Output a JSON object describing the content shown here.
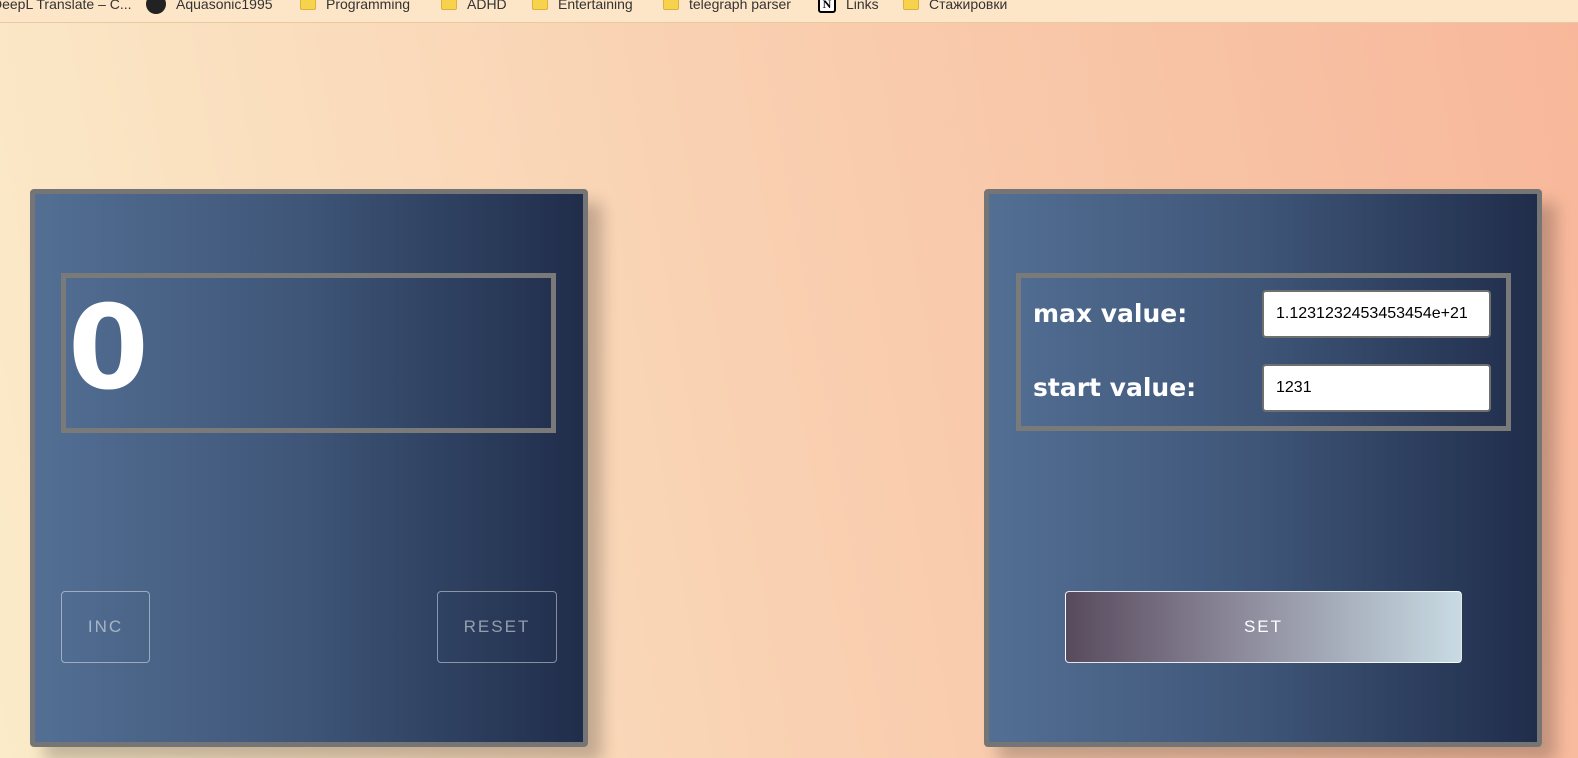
{
  "bookmarks": [
    {
      "label": "DeepL Translate – C...",
      "icon": "translate-icon"
    },
    {
      "label": "Aquasonic1995",
      "icon": "github-icon"
    },
    {
      "label": "Programming",
      "icon": "folder-icon"
    },
    {
      "label": "ADHD",
      "icon": "folder-icon"
    },
    {
      "label": "Entertaining",
      "icon": "folder-icon"
    },
    {
      "label": "telegraph parser",
      "icon": "folder-icon"
    },
    {
      "label": "Links",
      "icon": "notion-icon"
    },
    {
      "label": "Стажировки",
      "icon": "folder-icon"
    }
  ],
  "counter": {
    "value": "0",
    "inc_label": "INC",
    "reset_label": "RESET"
  },
  "settings": {
    "max_label": "max value:",
    "max_value": "1.1231232453453454e+21",
    "start_label": "start value:",
    "start_value": "1231",
    "set_label": "SET"
  },
  "colors": {
    "panel_gradient_start": "#536f94",
    "panel_gradient_end": "#202d4b",
    "page_background_start": "#fbebc9",
    "page_background_end": "#f8b79a",
    "set_button_gradient_start": "#584a5d",
    "set_button_gradient_end": "#c8dbe3"
  }
}
